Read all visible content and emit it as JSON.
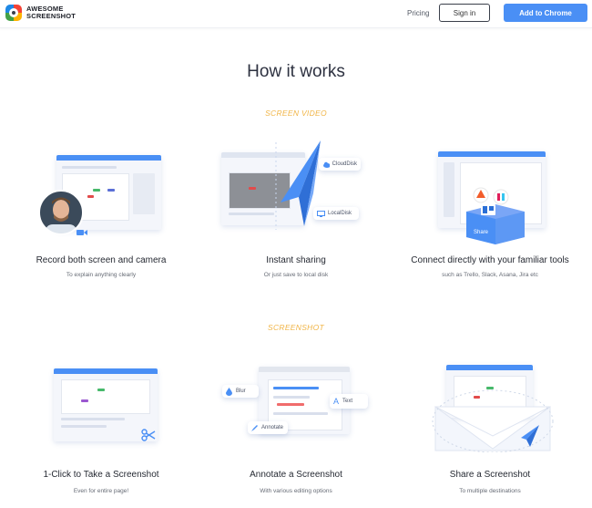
{
  "header": {
    "logo_line1": "AWESOME",
    "logo_line2": "SCREENSHOT",
    "pricing": "Pricing",
    "signin": "Sign in",
    "add_to_chrome": "Add to Chrome"
  },
  "page_title": "How it works",
  "sections": {
    "video_label": "SCREEN VIDEO",
    "screenshot_label": "SCREENSHOT"
  },
  "video_features": [
    {
      "title": "Record both screen and camera",
      "subtitle": "To explain anything clearly"
    },
    {
      "title": "Instant sharing",
      "subtitle": "Or just save to local disk"
    },
    {
      "title": "Connect directly with your familiar tools",
      "subtitle": "such as Trello, Slack, Asana, Jira etc"
    }
  ],
  "screenshot_features": [
    {
      "title": "1-Click to Take a Screenshot",
      "subtitle": "Even for entire page!"
    },
    {
      "title": "Annotate a Screenshot",
      "subtitle": "With various editing options"
    },
    {
      "title": "Share a Screenshot",
      "subtitle": "To multiple destinations"
    }
  ],
  "illustration_labels": {
    "cloud": "CloudDisk",
    "local": "LocalDisk",
    "blur": "Blur",
    "text": "Text",
    "annotate": "Annotate",
    "share": "Share"
  },
  "colors": {
    "accent": "#4a8ff5",
    "section": "#f1b547"
  }
}
